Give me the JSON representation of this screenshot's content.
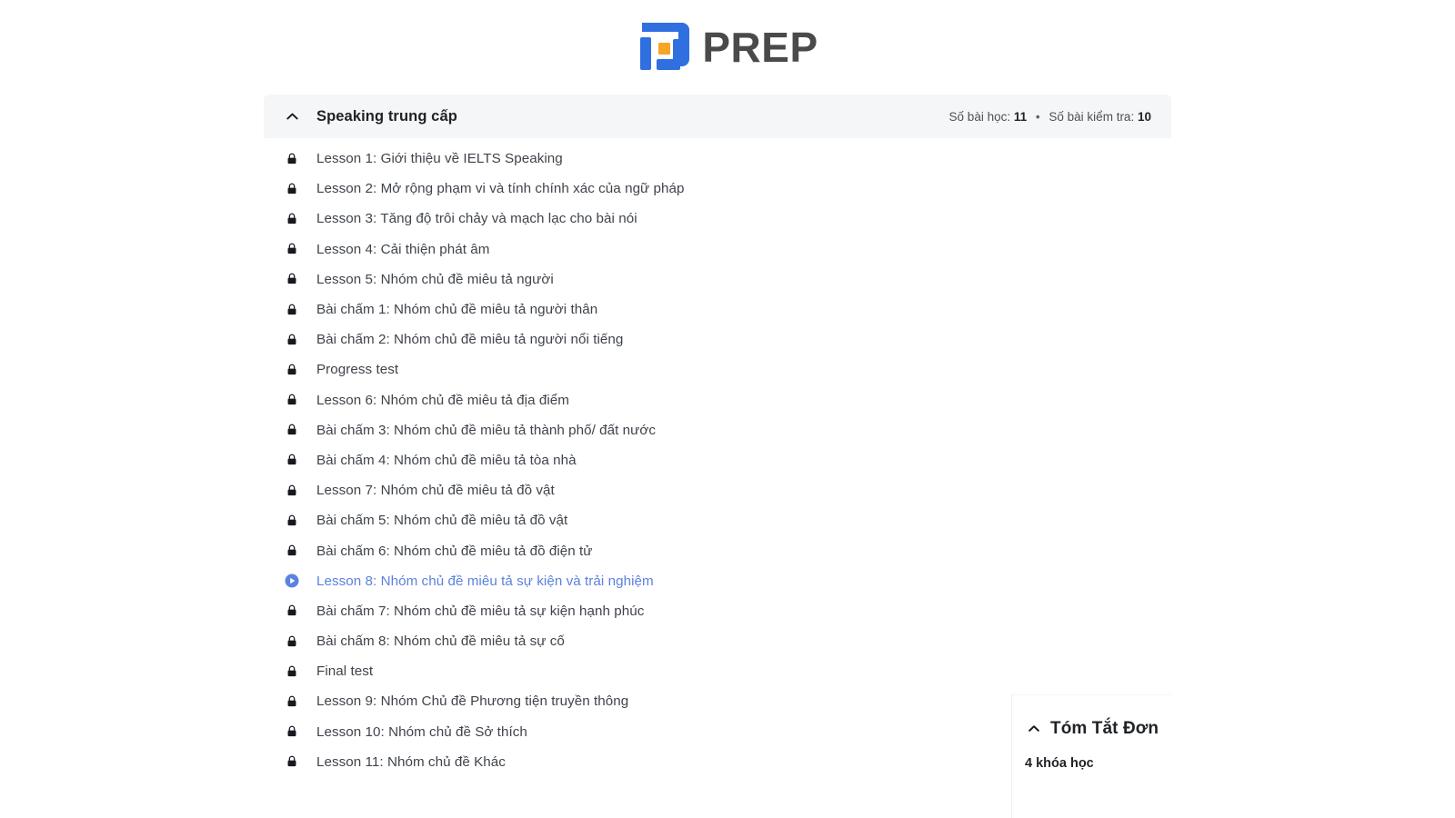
{
  "brand": {
    "name": "PREP",
    "logo_icon": "prep-logo-mark",
    "colors": {
      "blue": "#2f6fe0",
      "orange": "#f5a623",
      "wordmark": "#4a4a4a"
    }
  },
  "course_card": {
    "collapse_icon": "chevron-up-icon",
    "title": "Speaking trung cấp",
    "meta": {
      "lessons_label": "Số bài học:",
      "lessons_count": "11",
      "separator": "•",
      "tests_label": "Số bài kiểm tra:",
      "tests_count": "10"
    },
    "accent_color": "#5b82e0",
    "items": [
      {
        "icon": "lock-icon",
        "label": "Lesson 1: Giới thiệu về IELTS Speaking",
        "state": "locked"
      },
      {
        "icon": "lock-icon",
        "label": "Lesson 2: Mở rộng phạm vi và tính chính xác của ngữ pháp",
        "state": "locked"
      },
      {
        "icon": "lock-icon",
        "label": "Lesson 3: Tăng độ trôi chảy và mạch lạc cho bài nói",
        "state": "locked"
      },
      {
        "icon": "lock-icon",
        "label": "Lesson 4: Cải thiện phát âm",
        "state": "locked"
      },
      {
        "icon": "lock-icon",
        "label": "Lesson 5: Nhóm chủ đề miêu tả người",
        "state": "locked"
      },
      {
        "icon": "lock-icon",
        "label": "Bài chấm 1: Nhóm chủ đề miêu tả người thân",
        "state": "locked"
      },
      {
        "icon": "lock-icon",
        "label": "Bài chấm 2: Nhóm chủ đề miêu tả người nổi tiếng",
        "state": "locked"
      },
      {
        "icon": "lock-icon",
        "label": "Progress test",
        "state": "locked"
      },
      {
        "icon": "lock-icon",
        "label": "Lesson 6: Nhóm chủ đề miêu tả địa điểm",
        "state": "locked"
      },
      {
        "icon": "lock-icon",
        "label": "Bài chấm 3: Nhóm chủ đề miêu tả thành phố/ đất nước",
        "state": "locked"
      },
      {
        "icon": "lock-icon",
        "label": "Bài chấm 4: Nhóm chủ đề miêu tả tòa nhà",
        "state": "locked"
      },
      {
        "icon": "lock-icon",
        "label": "Lesson 7: Nhóm chủ đề miêu tả đồ vật",
        "state": "locked"
      },
      {
        "icon": "lock-icon",
        "label": "Bài chấm 5: Nhóm chủ đề miêu tả đồ vật",
        "state": "locked"
      },
      {
        "icon": "lock-icon",
        "label": "Bài chấm 6: Nhóm chủ đề miêu tả đồ điện tử",
        "state": "locked"
      },
      {
        "icon": "play-circle-icon",
        "label": "Lesson 8: Nhóm chủ đề miêu tả sự kiện và trải nghiệm",
        "state": "active"
      },
      {
        "icon": "lock-icon",
        "label": "Bài chấm 7: Nhóm chủ đề miêu tả sự kiện hạnh phúc",
        "state": "locked"
      },
      {
        "icon": "lock-icon",
        "label": "Bài chấm 8: Nhóm chủ đề miêu tả sự cố",
        "state": "locked"
      },
      {
        "icon": "lock-icon",
        "label": "Final test",
        "state": "locked"
      },
      {
        "icon": "lock-icon",
        "label": "Lesson 9: Nhóm Chủ đề Phương tiện truyền thông",
        "state": "locked"
      },
      {
        "icon": "lock-icon",
        "label": "Lesson 10: Nhóm chủ đề Sở thích",
        "state": "locked"
      },
      {
        "icon": "lock-icon",
        "label": "Lesson 11: Nhóm chủ đề Khác",
        "state": "locked"
      }
    ]
  },
  "summary_panel": {
    "collapse_icon": "chevron-up-icon",
    "title": "Tóm Tắt Đơn",
    "subtitle": "4 khóa học"
  }
}
